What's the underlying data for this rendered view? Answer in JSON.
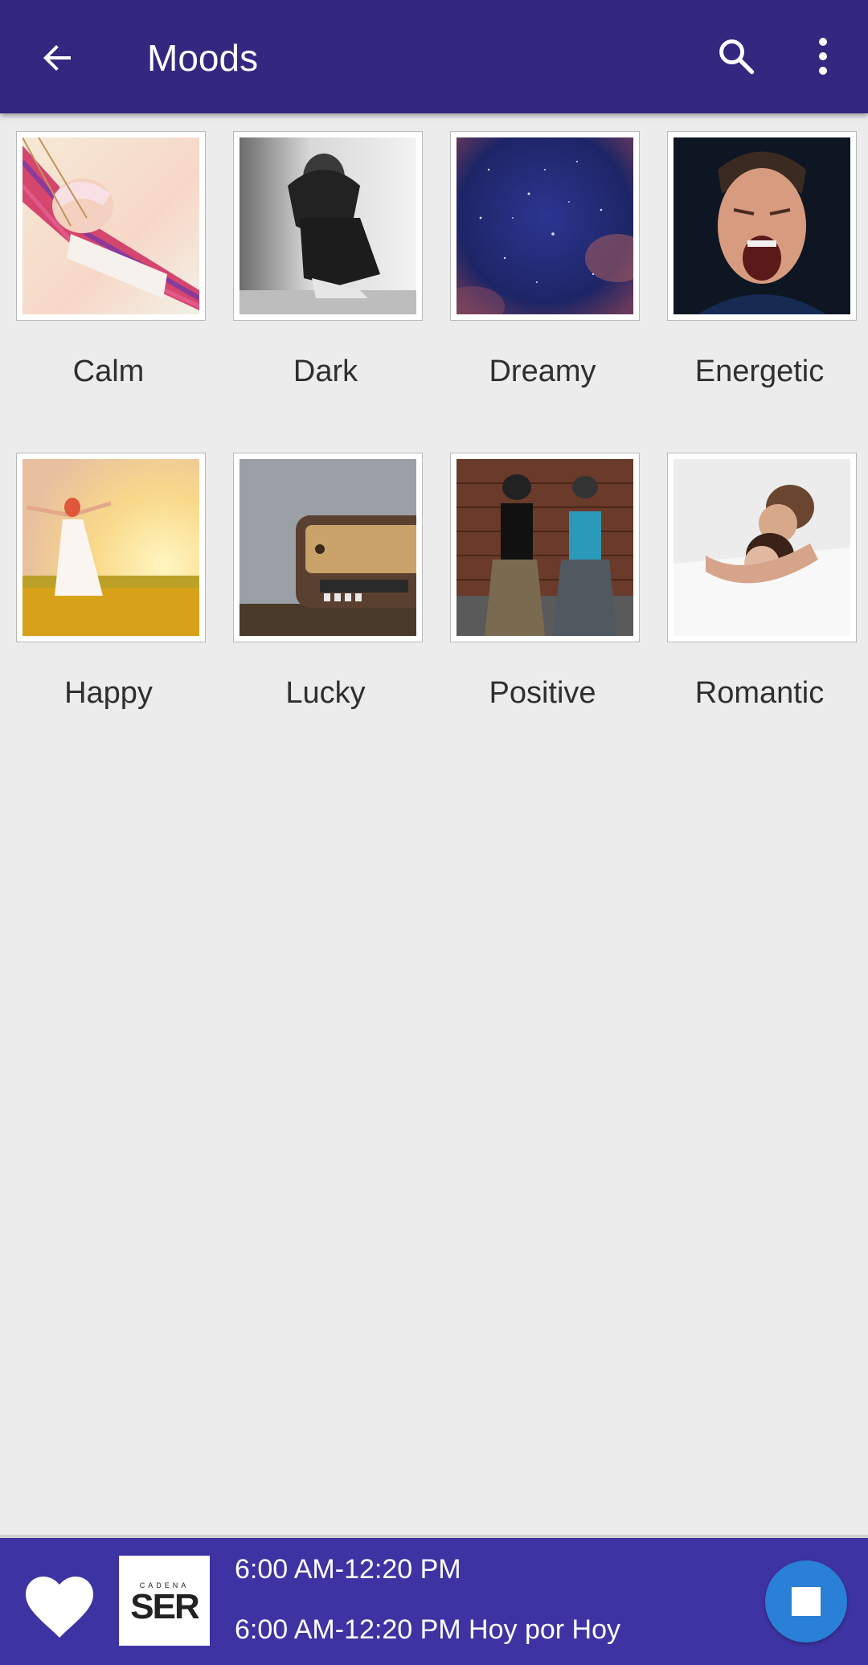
{
  "app_bar": {
    "title": "Moods",
    "back_icon": "arrow-left-icon",
    "search_icon": "search-icon",
    "more_icon": "more-vert-icon",
    "color": "#33277f"
  },
  "moods": [
    {
      "label": "Calm"
    },
    {
      "label": "Dark"
    },
    {
      "label": "Dreamy"
    },
    {
      "label": "Energetic"
    },
    {
      "label": "Happy"
    },
    {
      "label": "Lucky"
    },
    {
      "label": "Positive"
    },
    {
      "label": "Romantic"
    }
  ],
  "player": {
    "favorite_icon": "heart-icon",
    "station_logo_small": "CADENA",
    "station_logo_big": "SER",
    "line1": "6:00 AM-12:20 PM",
    "line2": "6:00 AM-12:20 PM Hoy por Hoy",
    "stop_icon": "stop-icon",
    "color": "#3e33a3",
    "stop_color": "#2a80d6"
  }
}
